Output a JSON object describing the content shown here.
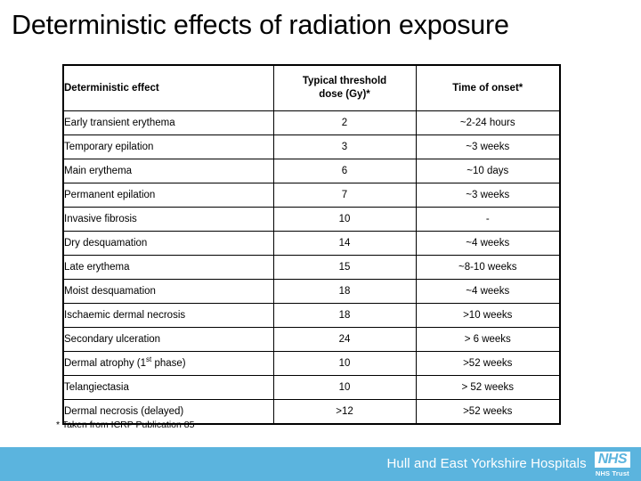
{
  "slide": {
    "title": "Deterministic effects of radiation exposure",
    "footnote": "* Taken from ICRP Publication 85"
  },
  "table": {
    "headers": {
      "effect": "Deterministic effect",
      "dose_line1": "Typical threshold",
      "dose_line2": "dose (Gy)*",
      "onset": "Time of onset*"
    },
    "rows": [
      {
        "effect": "Early transient erythema",
        "dose": "2",
        "onset": "~2-24 hours",
        "group_start": false
      },
      {
        "effect": "Temporary epilation",
        "dose": "3",
        "onset": "~3 weeks",
        "group_start": false
      },
      {
        "effect": "Main erythema",
        "dose": "6",
        "onset": "~10 days",
        "group_start": true
      },
      {
        "effect": "Permanent epilation",
        "dose": "7",
        "onset": "~3 weeks",
        "group_start": false
      },
      {
        "effect": "Invasive fibrosis",
        "dose": "10",
        "onset": "-",
        "group_start": true
      },
      {
        "effect": "Dry desquamation",
        "dose": "14",
        "onset": "~4 weeks",
        "group_start": false
      },
      {
        "effect": "Late erythema",
        "dose": "15",
        "onset": "~8-10 weeks",
        "group_start": false
      },
      {
        "effect": "Moist desquamation",
        "dose": "18",
        "onset": "~4 weeks",
        "group_start": false
      },
      {
        "effect": "Ischaemic dermal necrosis",
        "dose": "18",
        "onset": ">10 weeks",
        "group_start": false
      },
      {
        "effect": "Secondary ulceration",
        "dose": "24",
        "onset": "> 6 weeks",
        "group_start": true
      },
      {
        "effect": "Dermal atrophy (1st phase)",
        "effect_pre": "Dermal atrophy (1",
        "effect_sup": "st",
        "effect_post": " phase)",
        "dose": "10",
        "onset": ">52 weeks",
        "group_start": false
      },
      {
        "effect": "Telangiectasia",
        "dose": "10",
        "onset": "> 52 weeks",
        "group_start": false
      },
      {
        "effect": "Dermal necrosis (delayed)",
        "dose": ">12",
        "onset": ">52 weeks",
        "group_start": false
      }
    ]
  },
  "banner": {
    "trust_name": "Hull and East Yorkshire Hospitals",
    "logo_text": "NHS",
    "logo_sub": "NHS Trust",
    "background_color": "#5bb4de"
  }
}
